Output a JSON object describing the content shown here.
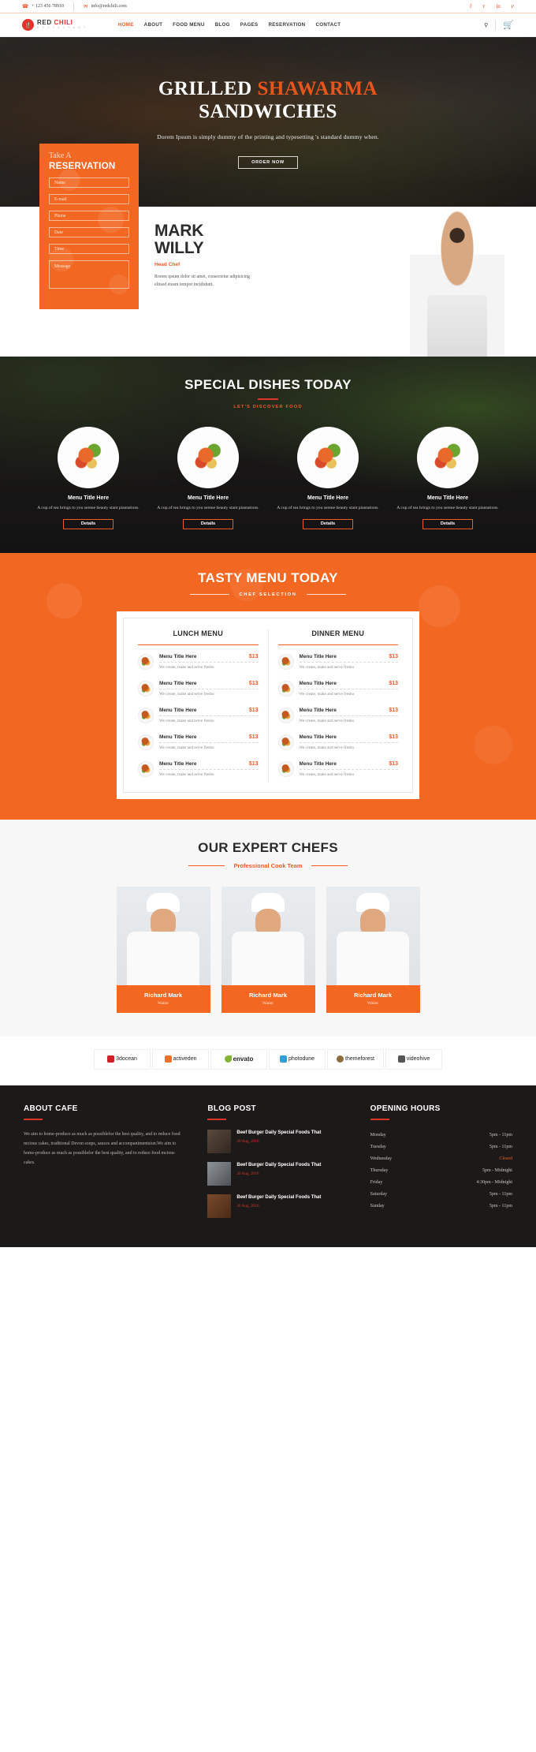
{
  "topbar": {
    "phone": "+ 123 456 78910",
    "email": "info@redchili.com",
    "phone_icon": "phone-icon",
    "email_icon": "envelope-icon",
    "social": [
      {
        "name": "facebook-icon",
        "glyph": "f"
      },
      {
        "name": "twitter-icon",
        "glyph": "ᴛ"
      },
      {
        "name": "linkedin-icon",
        "glyph": "in"
      },
      {
        "name": "pinterest-icon",
        "glyph": "ᴘ"
      }
    ]
  },
  "brand": {
    "name_first": "RED ",
    "name_second": "CHILI",
    "tagline": "R E S T A U R A N T",
    "badge_icon": "chili-logo-icon"
  },
  "nav": {
    "items": [
      {
        "label": "HOME",
        "active": true
      },
      {
        "label": "ABOUT",
        "active": false
      },
      {
        "label": "FOOD MENU",
        "active": false
      },
      {
        "label": "BLOG",
        "active": false
      },
      {
        "label": "PAGES",
        "active": false
      },
      {
        "label": "RESERVATION",
        "active": false
      },
      {
        "label": "CONTACT",
        "active": false
      }
    ],
    "search_icon": "search-icon",
    "cart_icon": "shopping-cart-icon"
  },
  "hero": {
    "title_line1_plain": "GRILLED ",
    "title_line1_accent": "SHAWARMA",
    "title_line2": "SANDWICHES",
    "subtitle": "Dorem Ipsum is simply dummy of the printing and typesetting 's standard dummy when.",
    "button": "ORDER NOW"
  },
  "reservation": {
    "eyebrow": "Take A",
    "title": "RESERVATION",
    "fields": [
      {
        "name": "name-field",
        "placeholder": "Name"
      },
      {
        "name": "email-field",
        "placeholder": "E-mail"
      },
      {
        "name": "phone-field",
        "placeholder": "Phone"
      },
      {
        "name": "date-field",
        "placeholder": "Date"
      },
      {
        "name": "time-field",
        "placeholder": "Time"
      }
    ],
    "message_placeholder": "Message"
  },
  "chef_intro": {
    "first_name": "MARK",
    "last_name": "WILLY",
    "role": "Head Chef",
    "description": "Rorem ipsum dolor sit amet, consectetur adipisicing elitsed eiusm tempor incididunt."
  },
  "special": {
    "title": "SPECIAL DISHES TODAY",
    "subtitle": "LET'S DISCOVER FOOD",
    "dishes": [
      {
        "title": "Menu Title Here",
        "desc": "A cup of tea brings to you serene beauty stant plantations.",
        "button": "Details"
      },
      {
        "title": "Menu Title Here",
        "desc": "A cup of tea brings to you serene beauty stant plantations.",
        "button": "Details"
      },
      {
        "title": "Menu Title Here",
        "desc": "A cup of tea brings to you serene beauty stant plantations.",
        "button": "Details"
      },
      {
        "title": "Menu Title Here",
        "desc": "A cup of tea brings to you serene beauty stant plantations.",
        "button": "Details"
      }
    ]
  },
  "tasty": {
    "title": "TASTY MENU TODAY",
    "subtitle": "CHEF SELECTION",
    "columns": [
      {
        "heading": "LUNCH MENU",
        "items": [
          {
            "name": "Menu Title Here",
            "price": "$13",
            "desc": "We create, make and serve fresho"
          },
          {
            "name": "Menu Title Here",
            "price": "$13",
            "desc": "We create, make and serve fresho"
          },
          {
            "name": "Menu Title Here",
            "price": "$13",
            "desc": "We create, make and serve fresho"
          },
          {
            "name": "Menu Title Here",
            "price": "$13",
            "desc": "We create, make and serve fresho"
          },
          {
            "name": "Menu Title Here",
            "price": "$13",
            "desc": "We create, make and serve fresho"
          }
        ]
      },
      {
        "heading": "DINNER MENU",
        "items": [
          {
            "name": "Menu Title Here",
            "price": "$13",
            "desc": "We create, make and serve fresho"
          },
          {
            "name": "Menu Title Here",
            "price": "$13",
            "desc": "We create, make and serve fresho"
          },
          {
            "name": "Menu Title Here",
            "price": "$13",
            "desc": "We create, make and serve fresho"
          },
          {
            "name": "Menu Title Here",
            "price": "$13",
            "desc": "We create, make and serve fresho"
          },
          {
            "name": "Menu Title Here",
            "price": "$13",
            "desc": "We create, make and serve fresho"
          }
        ]
      }
    ]
  },
  "experts": {
    "title": "OUR EXPERT CHEFS",
    "subtitle": "Professional Cook Team",
    "members": [
      {
        "name": "Richard Mark",
        "role": "Waiter"
      },
      {
        "name": "Richard Mark",
        "role": "Waiter"
      },
      {
        "name": "Richard Mark",
        "role": "Waiter"
      }
    ]
  },
  "brands": [
    {
      "label": "3docean",
      "color": "#cf2026"
    },
    {
      "label": "activeden",
      "color": "#e8712c"
    },
    {
      "label": "envato",
      "color": "#7fb535"
    },
    {
      "label": "photodune",
      "color": "#2f9fd6"
    },
    {
      "label": "themeforest",
      "color": "#8a6d3b"
    },
    {
      "label": "videohive",
      "color": "#555555"
    }
  ],
  "footer": {
    "about": {
      "title": "ABOUT CAFE",
      "text": "We aim to home-produce as much as possiblefor the best quality, and to reduce food mcious cakes, traditional Devon soups, sauces and accompanimentsion.We aim to home-produce as much as possiblefor the best quality, and to reduce food mcious cakes."
    },
    "blog": {
      "title": "BLOG POST",
      "posts": [
        {
          "title": "Beef Burger Daily Special Foods That",
          "date": "20 Aug, 2016"
        },
        {
          "title": "Beef Burger Daily Special Foods That",
          "date": "20 Aug, 2016"
        },
        {
          "title": "Beef Burger Daily Special Foods That",
          "date": "20 Aug, 2016"
        }
      ]
    },
    "hours": {
      "title": "OPENING HOURS",
      "rows": [
        {
          "day": "Monday",
          "time": "5pm - 11pm",
          "closed": false
        },
        {
          "day": "Tuesday",
          "time": "5pm - 11pm",
          "closed": false
        },
        {
          "day": "Wednesday",
          "time": "Closed",
          "closed": true
        },
        {
          "day": "Thursday",
          "time": "5pm - Midnight",
          "closed": false
        },
        {
          "day": "Friday",
          "time": "4:30pm - Midnight",
          "closed": false
        },
        {
          "day": "Saturday",
          "time": "5pm - 11pm",
          "closed": false
        },
        {
          "day": "Sunday",
          "time": "5pm - 11pm",
          "closed": false
        }
      ]
    }
  }
}
